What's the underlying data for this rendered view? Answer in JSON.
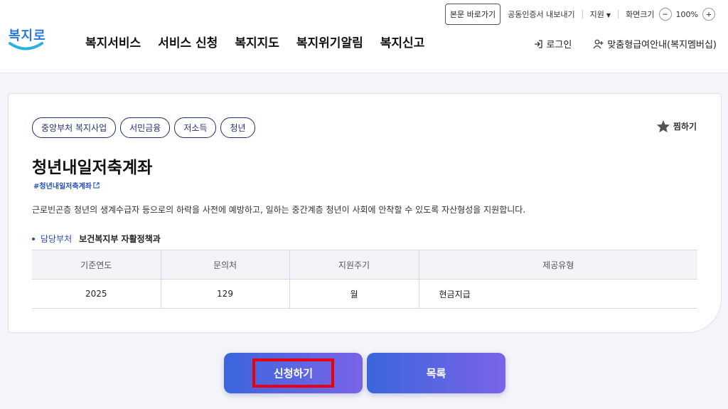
{
  "header": {
    "skip_link": "본문 바로가기",
    "cert_export": "공동인증서 내보내기",
    "support": "지원",
    "zoom_label": "화면크기",
    "zoom_minus": "−",
    "zoom_value": "100%",
    "zoom_plus": "+",
    "logo_text": "복지로",
    "nav": [
      "복지서비스",
      "서비스 신청",
      "복지지도",
      "복지위기알림",
      "복지신고"
    ],
    "login": "로그인",
    "member_info": "맞춤형급여안내(복지멤버십)"
  },
  "service": {
    "tags": [
      "중앙부처 복지사업",
      "서민금융",
      "저소득",
      "청년"
    ],
    "favorite_label": "찜하기",
    "title": "청년내일저축계좌",
    "hashtag": "#청년내일저축계좌",
    "description": "근로빈곤층 청년의 생계수급자 등으로의 하락을 사전에 예방하고, 일하는 중간계층 청년이 사회에 안착할 수 있도록 자산형성을 지원합니다.",
    "dept_label": "담당부처",
    "dept_value": "보건복지부 자활정책과",
    "table": {
      "headers": [
        "기준연도",
        "문의처",
        "지원주기",
        "제공유형"
      ],
      "row": [
        "2025",
        "129",
        "월",
        "현금지급"
      ]
    }
  },
  "actions": {
    "apply": "신청하기",
    "list": "목록"
  },
  "colors": {
    "primary": "#2850b8",
    "button_gradient_start": "#3b66db",
    "button_gradient_end": "#7a64e8",
    "highlight": "#e8000f"
  }
}
